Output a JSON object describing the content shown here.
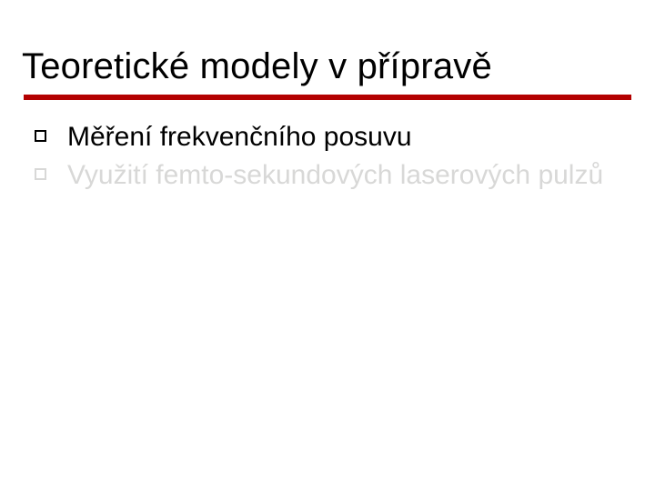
{
  "title": "Teoretické modely v přípravě",
  "bullets": [
    {
      "text": "Měření frekvenčního posuvu"
    },
    {
      "text": "Využití femto-sekundových laserových pulzů"
    }
  ],
  "colors": {
    "accent_rule": "#b30000",
    "text_normal": "#000000",
    "text_faded": "#d8d8d7"
  }
}
